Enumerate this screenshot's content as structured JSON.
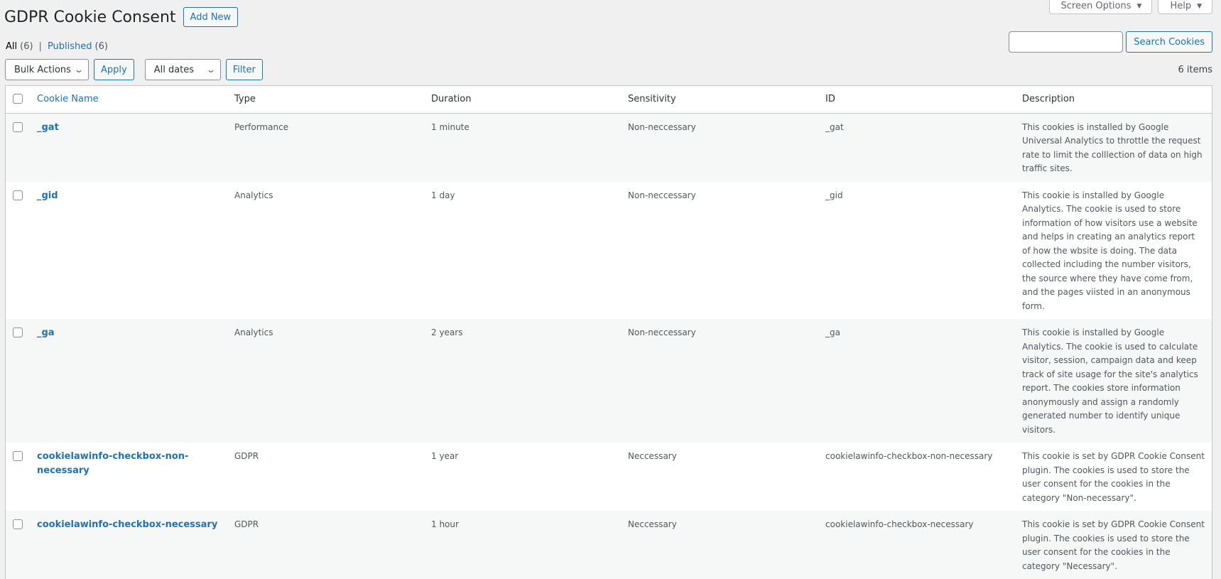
{
  "screen_meta": {
    "screen_options_label": "Screen Options",
    "help_label": "Help"
  },
  "header": {
    "title": "GDPR Cookie Consent",
    "add_new_label": "Add New"
  },
  "views": {
    "all_label": "All",
    "all_count": "(6)",
    "separator": "|",
    "published_label": "Published",
    "published_count": "(6)"
  },
  "search": {
    "value": "",
    "button_label": "Search Cookies"
  },
  "tablenav": {
    "bulk_actions_selected": "Bulk Actions",
    "apply_label": "Apply",
    "dates_selected": "All dates",
    "filter_label": "Filter",
    "items_count": "6 items"
  },
  "table": {
    "columns": {
      "name": "Cookie Name",
      "type": "Type",
      "duration": "Duration",
      "sensitivity": "Sensitivity",
      "id": "ID",
      "description": "Description"
    },
    "rows": [
      {
        "name": "_gat",
        "type": "Performance",
        "duration": "1 minute",
        "sensitivity": "Non-neccessary",
        "id": "_gat",
        "description": "This cookies is installed by Google Universal Analytics to throttle the request rate to limit the colllection of data on high traffic sites."
      },
      {
        "name": "_gid",
        "type": "Analytics",
        "duration": "1 day",
        "sensitivity": "Non-neccessary",
        "id": "_gid",
        "description": "This cookie is installed by Google Analytics. The cookie is used to store information of how visitors use a website and helps in creating an analytics report of how the wbsite is doing. The data collected including the number visitors, the source where they have come from, and the pages viisted in an anonymous form."
      },
      {
        "name": "_ga",
        "type": "Analytics",
        "duration": "2 years",
        "sensitivity": "Non-neccessary",
        "id": "_ga",
        "description": "This cookie is installed by Google Analytics. The cookie is used to calculate visitor, session, campaign data and keep track of site usage for the site's analytics report. The cookies store information anonymously and assign a randomly generated number to identify unique visitors."
      },
      {
        "name": "cookielawinfo-checkbox-non-necessary",
        "type": "GDPR",
        "duration": "1 year",
        "sensitivity": "Neccessary",
        "id": "cookielawinfo-checkbox-non-necessary",
        "description": "This cookie is set by GDPR Cookie Consent plugin. The cookies is used to store the user consent for the cookies in the category \"Non-necessary\"."
      },
      {
        "name": "cookielawinfo-checkbox-necessary",
        "type": "GDPR",
        "duration": "1 hour",
        "sensitivity": "Neccessary",
        "id": "cookielawinfo-checkbox-necessary",
        "description": "This cookie is set by GDPR Cookie Consent plugin. The cookies is used to store the user consent for the cookies in the category \"Necessary\"."
      }
    ]
  }
}
